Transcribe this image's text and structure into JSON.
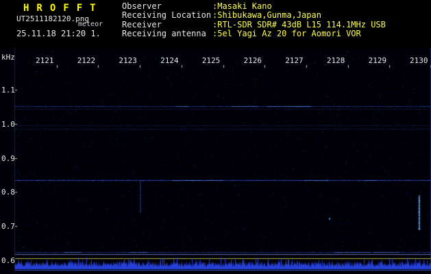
{
  "header": {
    "app_title": "HROFFT",
    "file_name": "UT2511182120.png",
    "file_tag": "meteor",
    "datetime_line": "25.11.18 21:20   1.",
    "info": {
      "rows": [
        {
          "label": "Observer",
          "value": ":Masaki Kano"
        },
        {
          "label": "Receiving Location",
          "value": ":Shibukawa,Gunma,Japan"
        },
        {
          "label": "Receiver",
          "value": ":RTL-SDR SDR# 43dB L15 114.1MHz USB"
        },
        {
          "label": "Receiving antenna",
          "value": ":5el Yagi Az 20 for Aomori VOR"
        }
      ]
    }
  },
  "axes": {
    "y_unit": "kHz",
    "y_ticks": [
      "1.1",
      "1.0",
      "0.9",
      "0.8",
      "0.7",
      "0.6"
    ],
    "x_ticks": [
      "2121",
      "2122",
      "2123",
      "2124",
      "2125",
      "2126",
      "2127",
      "2128",
      "2129",
      "2130"
    ]
  },
  "colors": {
    "background": "#000000",
    "title_yellow": "#ffff00",
    "text_white": "#eaeaea",
    "value_yellow": "#ffff55",
    "noise_blue": "#2a46eb",
    "threshold_yellow": "#c8c850"
  },
  "chart_data": {
    "type": "heatmap",
    "description_type": "10-minute radio meteor observation spectrogram (waterfall) with signal-level strip",
    "x_ticks": [
      "2121",
      "2122",
      "2123",
      "2124",
      "2125",
      "2126",
      "2127",
      "2128",
      "2129",
      "2130"
    ],
    "x_start": "2120",
    "x_end": "2130",
    "x_range_minutes": 10,
    "y_unit": "kHz",
    "y_ticks": [
      1.1,
      1.0,
      0.9,
      0.8,
      0.7,
      0.6
    ],
    "y_range_khz": [
      0.6,
      1.21
    ],
    "carrier_lines": [
      {
        "freq_khz": 1.052,
        "strength": "medium"
      },
      {
        "freq_khz": 1.043,
        "strength": "faint"
      },
      {
        "freq_khz": 0.995,
        "strength": "faint"
      },
      {
        "freq_khz": 0.986,
        "strength": "faint"
      },
      {
        "freq_khz": 0.835,
        "strength": "strong"
      },
      {
        "freq_khz": 0.625,
        "strength": "medium"
      }
    ],
    "echo_events": [
      {
        "time_min_after_2120": 3.0,
        "freq_khz_hi": 0.835,
        "freq_khz_lo": 0.74,
        "strength": "faint"
      },
      {
        "time_min_after_2120": 7.55,
        "freq_khz_hi": 0.725,
        "freq_khz_lo": 0.72,
        "strength": "dot"
      },
      {
        "time_min_after_2120": 9.7,
        "freq_khz_hi": 0.79,
        "freq_khz_lo": 0.69,
        "strength": "strong"
      }
    ],
    "noise_floor": "sparse dark-blue speckle",
    "bottom_strip": {
      "content": "signal-level trace",
      "trace_color": "#2a46eb",
      "threshold_line_color": "#c8c850"
    }
  }
}
